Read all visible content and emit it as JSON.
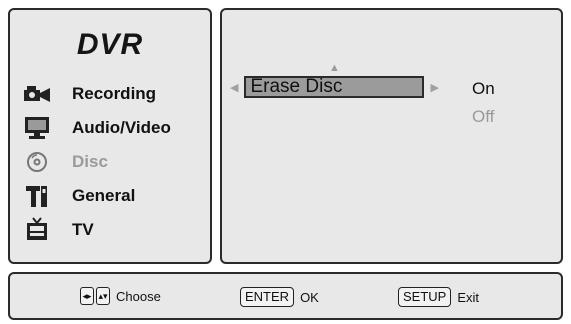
{
  "sidebar": {
    "title": "DVR",
    "items": [
      {
        "label": "Recording",
        "icon": "camera-icon",
        "disabled": false
      },
      {
        "label": "Audio/Video",
        "icon": "monitor-icon",
        "disabled": false
      },
      {
        "label": "Disc",
        "icon": "disc-icon",
        "disabled": true
      },
      {
        "label": "General",
        "icon": "tools-icon",
        "disabled": false
      },
      {
        "label": "TV",
        "icon": "tv-icon",
        "disabled": false
      }
    ]
  },
  "settings": {
    "selected_item": "Erase Disc",
    "options": [
      "On",
      "Off"
    ],
    "selected_option": "On"
  },
  "footer": {
    "choose_label": "Choose",
    "enter_key": "ENTER",
    "enter_label": "OK",
    "setup_key": "SETUP",
    "setup_label": "Exit"
  },
  "colors": {
    "panel_bg": "#e8e8e8",
    "border": "#2b2b2b",
    "highlight": "#9b9b9b",
    "disabled_text": "#9a9a9a"
  }
}
